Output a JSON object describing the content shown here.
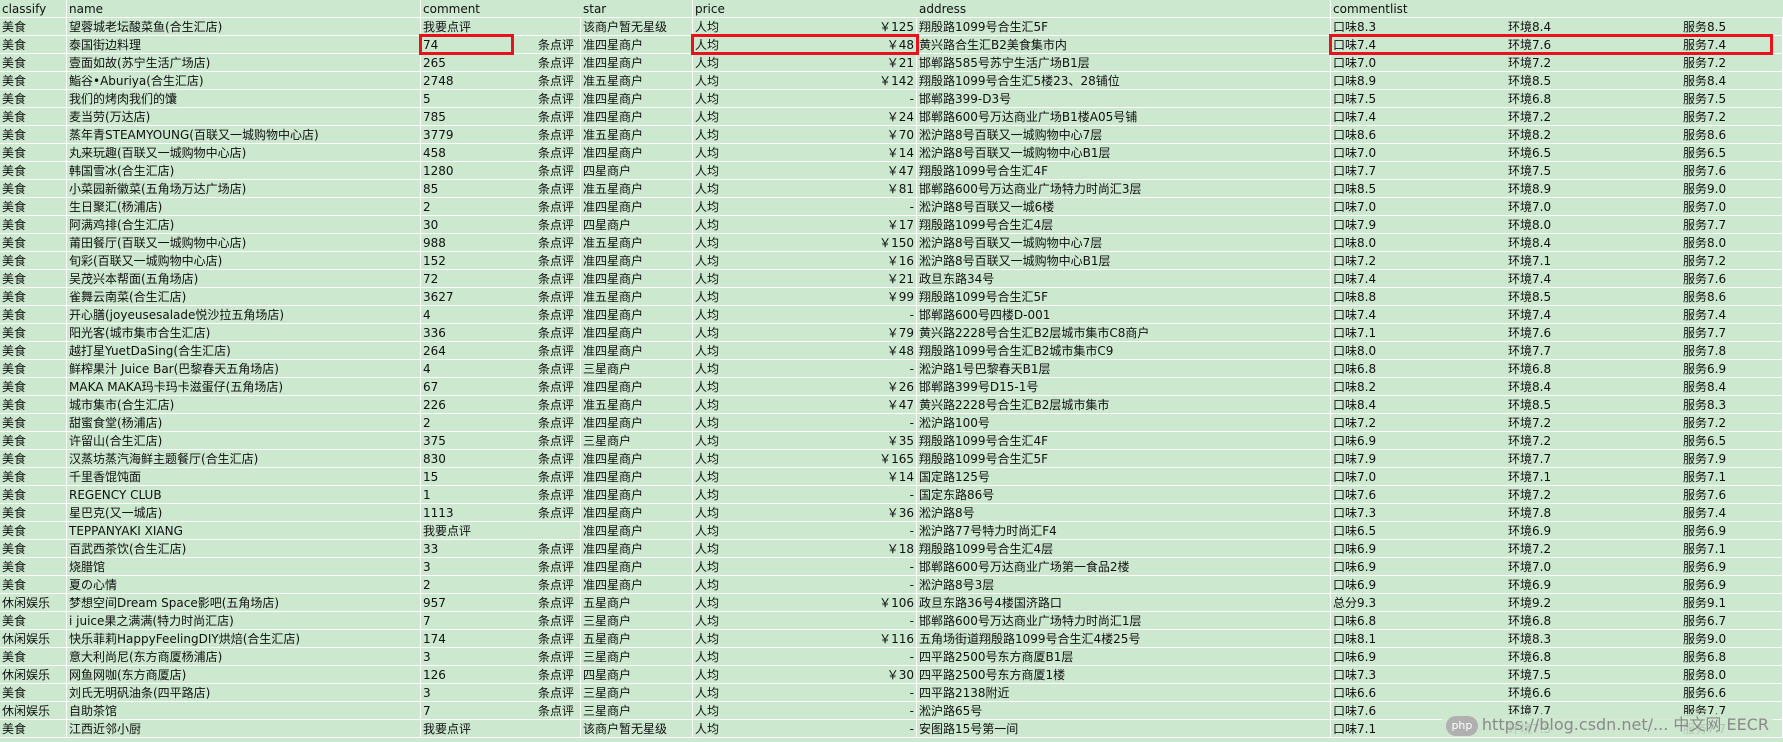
{
  "headers": [
    "classify",
    "name",
    "comment",
    "star",
    "price",
    "address",
    "commentlist"
  ],
  "comment_suffix": "条点评",
  "price_prefix": "人均",
  "rows": [
    [
      "美食",
      "望蓉城老坛酸菜鱼(合生汇店)",
      "我要点评",
      "",
      "该商户暂无星级",
      "人均",
      "￥125",
      "翔殷路1099号合生汇5F",
      "口味8.3",
      "环境8.4",
      "服务8.5"
    ],
    [
      "美食",
      "泰国街边料理",
      "74",
      "条点评",
      "准四星商户",
      "人均",
      "￥48",
      "黄兴路合生汇B2美食集市内",
      "口味7.4",
      "环境7.6",
      "服务7.4"
    ],
    [
      "美食",
      "壹面如故(苏宁生活广场店)",
      "265",
      "条点评",
      "准四星商户",
      "人均",
      "￥21",
      "邯郸路585号苏宁生活广场B1层",
      "口味7.0",
      "环境7.2",
      "服务7.2"
    ],
    [
      "美食",
      "鮨谷•Aburiya(合生汇店)",
      "2748",
      "条点评",
      "准五星商户",
      "人均",
      "￥142",
      "翔殷路1099号合生汇5楼23、28铺位",
      "口味8.9",
      "环境8.5",
      "服务8.4"
    ],
    [
      "美食",
      "我们的烤肉我们的馕",
      "5",
      "条点评",
      "准四星商户",
      "人均",
      "-",
      "邯郸路399-D3号",
      "口味7.5",
      "环境6.8",
      "服务7.5"
    ],
    [
      "美食",
      "麦当劳(万达店)",
      "785",
      "条点评",
      "准四星商户",
      "人均",
      "￥24",
      "邯郸路600号万达商业广场B1楼A05号铺",
      "口味7.4",
      "环境7.2",
      "服务7.2"
    ],
    [
      "美食",
      "蒸年青STEAMYOUNG(百联又一城购物中心店)",
      "3779",
      "条点评",
      "准五星商户",
      "人均",
      "￥70",
      "淞沪路8号百联又一城购物中心7层",
      "口味8.6",
      "环境8.2",
      "服务8.6"
    ],
    [
      "美食",
      "丸来玩趣(百联又一城购物中心店)",
      "458",
      "条点评",
      "准四星商户",
      "人均",
      "￥14",
      "淞沪路8号百联又一城购物中心B1层",
      "口味7.0",
      "环境6.5",
      "服务6.5"
    ],
    [
      "美食",
      "韩国雪冰(合生汇店)",
      "1280",
      "条点评",
      "四星商户",
      "人均",
      "￥47",
      "翔殷路1099号合生汇4F",
      "口味7.7",
      "环境7.5",
      "服务7.6"
    ],
    [
      "美食",
      "小菜园新徽菜(五角场万达广场店)",
      "85",
      "条点评",
      "准五星商户",
      "人均",
      "￥81",
      "邯郸路600号万达商业广场特力时尚汇3层",
      "口味8.5",
      "环境8.9",
      "服务9.0"
    ],
    [
      "美食",
      "生日聚汇(杨浦店)",
      "2",
      "条点评",
      "准四星商户",
      "人均",
      "-",
      "淞沪路8号百联又一城6楼",
      "口味7.0",
      "环境7.0",
      "服务7.0"
    ],
    [
      "美食",
      "阿满鸡排(合生汇店)",
      "30",
      "条点评",
      "四星商户",
      "人均",
      "￥17",
      "翔殷路1099号合生汇4层",
      "口味7.9",
      "环境8.0",
      "服务7.7"
    ],
    [
      "美食",
      "莆田餐厅(百联又一城购物中心店)",
      "988",
      "条点评",
      "准五星商户",
      "人均",
      "￥150",
      "淞沪路8号百联又一城购物中心7层",
      "口味8.0",
      "环境8.4",
      "服务8.0"
    ],
    [
      "美食",
      "旬彩(百联又一城购物中心店)",
      "152",
      "条点评",
      "准四星商户",
      "人均",
      "￥16",
      "淞沪路8号百联又一城购物中心B1层",
      "口味7.2",
      "环境7.1",
      "服务7.2"
    ],
    [
      "美食",
      "吴茂兴本帮面(五角场店)",
      "72",
      "条点评",
      "准四星商户",
      "人均",
      "￥21",
      "政旦东路34号",
      "口味7.4",
      "环境7.4",
      "服务7.6"
    ],
    [
      "美食",
      "雀舞云南菜(合生汇店)",
      "3627",
      "条点评",
      "准五星商户",
      "人均",
      "￥99",
      "翔殷路1099号合生汇5F",
      "口味8.8",
      "环境8.5",
      "服务8.6"
    ],
    [
      "美食",
      "开心膳(joyeusesalade悦沙拉五角场店)",
      "4",
      "条点评",
      "准四星商户",
      "人均",
      "-",
      "邯郸路600号四楼D-001",
      "口味7.4",
      "环境7.4",
      "服务7.4"
    ],
    [
      "美食",
      "阳光客(城市集市合生汇店)",
      "336",
      "条点评",
      "准四星商户",
      "人均",
      "￥79",
      "黄兴路2228号合生汇B2层城市集市C8商户",
      "口味7.1",
      "环境7.6",
      "服务7.7"
    ],
    [
      "美食",
      "越打星YuetDaSing(合生汇店)",
      "264",
      "条点评",
      "准四星商户",
      "人均",
      "￥48",
      "翔殷路1099号合生汇B2城市集市C9",
      "口味8.0",
      "环境7.7",
      "服务7.8"
    ],
    [
      "美食",
      "鲜榨果汁 Juice Bar(巴黎春天五角场店)",
      "4",
      "条点评",
      "三星商户",
      "人均",
      "-",
      "淞沪路1号巴黎春天B1层",
      "口味6.8",
      "环境6.8",
      "服务6.9"
    ],
    [
      "美食",
      "MAKA MAKA玛卡玛卡滋蛋仔(五角场店)",
      "67",
      "条点评",
      "准四星商户",
      "人均",
      "￥26",
      "邯郸路399号D15-1号",
      "口味8.2",
      "环境8.4",
      "服务8.4"
    ],
    [
      "美食",
      "城市集市(合生汇店)",
      "226",
      "条点评",
      "准五星商户",
      "人均",
      "￥47",
      "黄兴路2228号合生汇B2层城市集市",
      "口味8.4",
      "环境8.5",
      "服务8.3"
    ],
    [
      "美食",
      "甜蜜食堂(杨浦店)",
      "2",
      "条点评",
      "准四星商户",
      "人均",
      "-",
      "淞沪路100号",
      "口味7.2",
      "环境7.2",
      "服务7.2"
    ],
    [
      "美食",
      "许留山(合生汇店)",
      "375",
      "条点评",
      "三星商户",
      "人均",
      "￥35",
      "翔殷路1099号合生汇4F",
      "口味6.9",
      "环境7.2",
      "服务6.5"
    ],
    [
      "美食",
      "汉蒸坊蒸汽海鲜主题餐厅(合生汇店)",
      "830",
      "条点评",
      "准四星商户",
      "人均",
      "￥165",
      "翔殷路1099号合生汇5F",
      "口味7.9",
      "环境7.7",
      "服务7.9"
    ],
    [
      "美食",
      "千里香馄饨面",
      "15",
      "条点评",
      "准四星商户",
      "人均",
      "￥14",
      "国定路125号",
      "口味7.0",
      "环境7.1",
      "服务7.1"
    ],
    [
      "美食",
      "REGENCY CLUB",
      "1",
      "条点评",
      "准四星商户",
      "人均",
      "-",
      "国定东路86号",
      "口味7.6",
      "环境7.2",
      "服务7.6"
    ],
    [
      "美食",
      "星巴克(又一城店)",
      "1113",
      "条点评",
      "准四星商户",
      "人均",
      "￥36",
      "淞沪路8号",
      "口味7.3",
      "环境7.8",
      "服务7.4"
    ],
    [
      "美食",
      "TEPPANYAKI XIANG",
      "我要点评",
      "",
      "准四星商户",
      "人均",
      "-",
      "淞沪路77号特力时尚汇F4",
      "口味6.5",
      "环境6.9",
      "服务6.9"
    ],
    [
      "美食",
      "百武西茶饮(合生汇店)",
      "33",
      "条点评",
      "准四星商户",
      "人均",
      "￥18",
      "翔殷路1099号合生汇4层",
      "口味6.9",
      "环境7.2",
      "服务7.1"
    ],
    [
      "美食",
      "烧腊馆",
      "3",
      "条点评",
      "准四星商户",
      "人均",
      "-",
      "邯郸路600号万达商业广场第一食品2楼",
      "口味6.9",
      "环境7.0",
      "服务6.9"
    ],
    [
      "美食",
      "夏の心情",
      "2",
      "条点评",
      "准四星商户",
      "人均",
      "-",
      "淞沪路8号3层",
      "口味6.9",
      "环境6.9",
      "服务6.9"
    ],
    [
      "休闲娱乐",
      "梦想空间Dream Space影吧(五角场店)",
      "957",
      "条点评",
      "五星商户",
      "人均",
      "￥106",
      "政旦东路36号4楼国济路口",
      "总分9.3",
      "环境9.2",
      "服务9.1"
    ],
    [
      "美食",
      "i juice果之满满(特力时尚汇店)",
      "7",
      "条点评",
      "三星商户",
      "人均",
      "-",
      "邯郸路600号万达商业广场特力时尚汇1层",
      "口味6.8",
      "环境6.8",
      "服务6.7"
    ],
    [
      "休闲娱乐",
      "快乐菲莉HappyFeelingDIY烘焙(合生汇店)",
      "174",
      "条点评",
      "五星商户",
      "人均",
      "￥116",
      "五角场街道翔殷路1099号合生汇4楼25号",
      "口味8.1",
      "环境8.3",
      "服务9.0"
    ],
    [
      "美食",
      "意大利尚尼(东方商厦杨浦店)",
      "3",
      "条点评",
      "三星商户",
      "人均",
      "-",
      "四平路2500号东方商厦B1层",
      "口味6.9",
      "环境6.8",
      "服务6.8"
    ],
    [
      "休闲娱乐",
      "网鱼网咖(东方商厦店)",
      "126",
      "条点评",
      "四星商户",
      "人均",
      "￥30",
      "四平路2500号东方商厦1楼",
      "口味7.3",
      "环境7.5",
      "服务8.0"
    ],
    [
      "美食",
      "刘氏无明矾油条(四平路店)",
      "3",
      "条点评",
      "三星商户",
      "人均",
      "-",
      "四平路2138附近",
      "口味6.6",
      "环境6.6",
      "服务6.6"
    ],
    [
      "休闲娱乐",
      "自助茶馆",
      "7",
      "条点评",
      "三星商户",
      "人均",
      "-",
      "淞沪路65号",
      "口味7.6",
      "环境7.7",
      "服务7.7"
    ],
    [
      "美食",
      "江西近邻小厨",
      "我要点评",
      "",
      "该商户暂无星级",
      "人均",
      "-",
      "安图路15号第一间",
      "口味7.1",
      "环境7.5",
      "服务7.7"
    ]
  ],
  "watermark": {
    "logo_text": "php",
    "text": "https://blog.csdn.net/... 中文网 EECR"
  }
}
